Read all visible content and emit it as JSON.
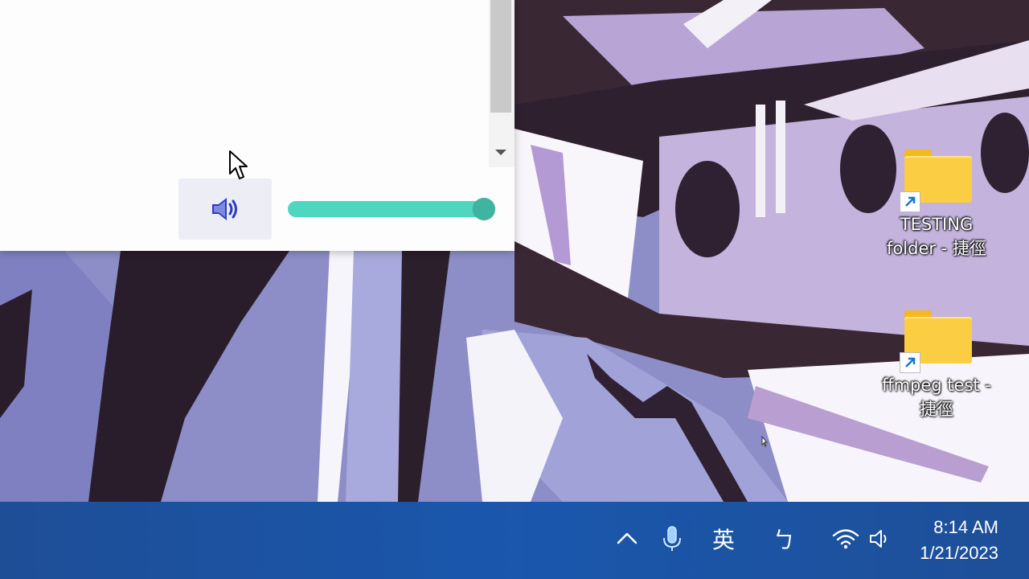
{
  "desktop": {
    "icons": [
      {
        "label_line1": "TESTING",
        "label_line2": "folder - 捷徑"
      },
      {
        "label_line1": "ffmpeg test -",
        "label_line2": "捷徑"
      }
    ]
  },
  "media_panel": {
    "volume_icon": "speaker-icon",
    "volume_level": 100
  },
  "taskbar": {
    "tray": {
      "chevron_icon": "chevron-up-icon",
      "mic_icon": "microphone-icon",
      "ime_mode": "英",
      "ime_bopomofo": "ㄅ",
      "wifi_icon": "wifi-icon",
      "speaker_icon": "speaker-icon"
    },
    "clock": {
      "time": "8:14 AM",
      "date": "1/21/2023"
    }
  },
  "colors": {
    "taskbar": "#1a57ad",
    "slider_track": "#4fd6c0",
    "slider_thumb": "#3fb5a1",
    "folder": "#fbcd43",
    "volume_icon": "#2a3cc4"
  }
}
